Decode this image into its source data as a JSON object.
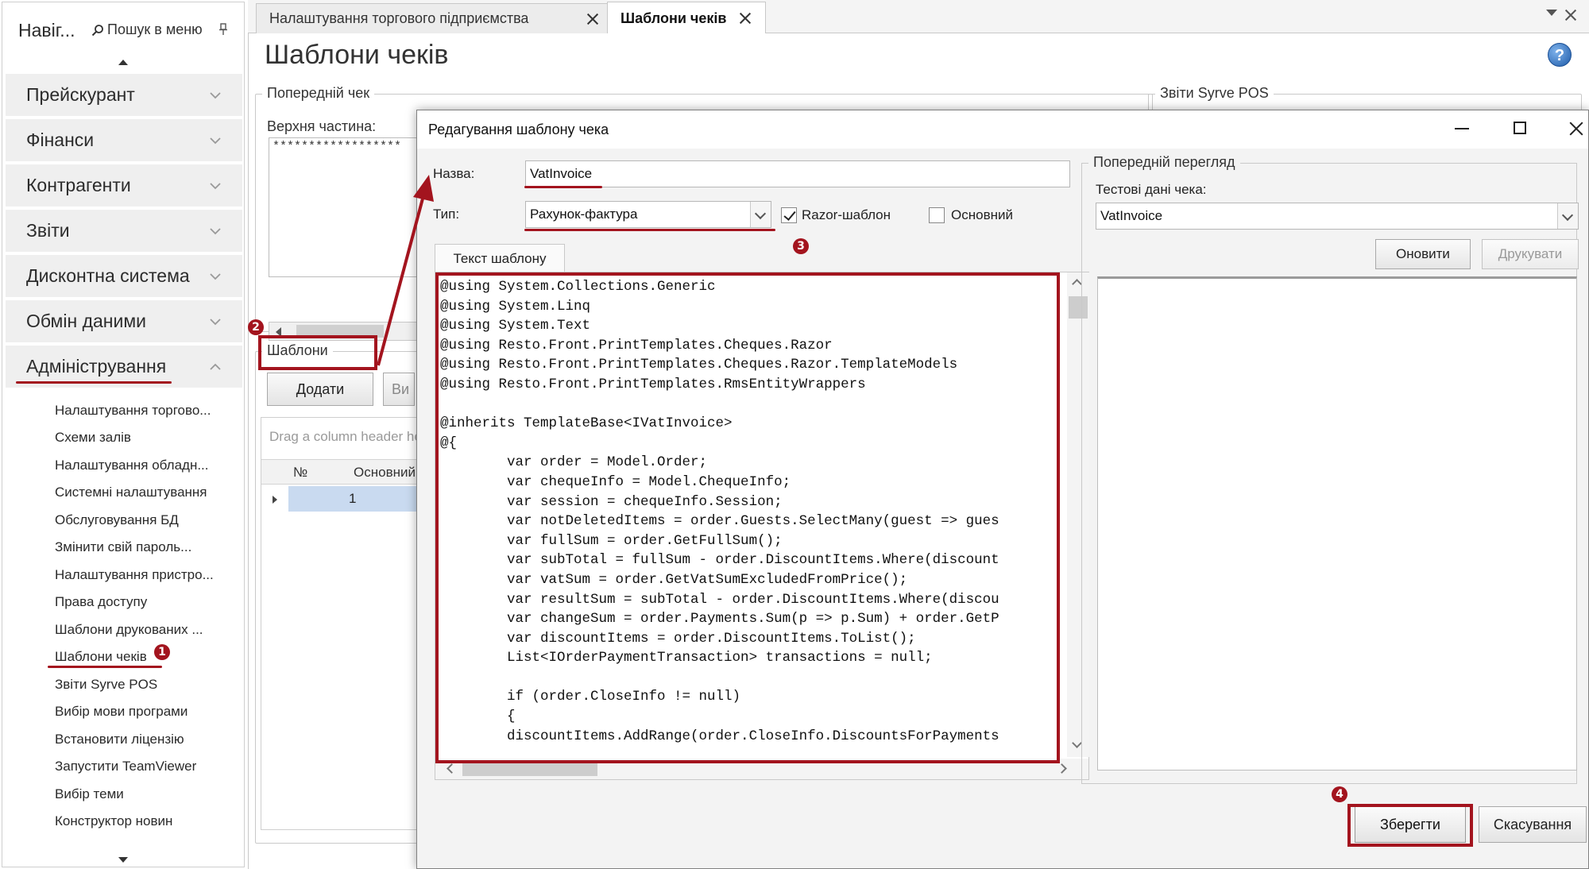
{
  "sidebar": {
    "title": "Навіг...",
    "search_label": "Пошук в меню",
    "groups": [
      {
        "label": "Прейскурант"
      },
      {
        "label": "Фінанси"
      },
      {
        "label": "Контрагенти"
      },
      {
        "label": "Звіти"
      },
      {
        "label": "Дисконтна система"
      },
      {
        "label": "Обмін даними"
      },
      {
        "label": "Адміністрування"
      }
    ],
    "admin_items": [
      "Налаштування торгово...",
      "Схеми залів",
      "Налаштування обладн...",
      "Системні налаштування",
      "Обслуговування БД",
      "Змінити свій пароль...",
      "Налаштування пристро...",
      "Права доступу",
      "Шаблони друкованих ...",
      "Шаблони чеків",
      "Звіти Syrve POS",
      "Вибір мови програми",
      "Встановити ліцензію",
      "Запустити TeamViewer",
      "Вибір теми",
      "Конструктор новин"
    ]
  },
  "tabs": [
    {
      "label": "Налаштування торгового підприємства"
    },
    {
      "label": "Шаблони чеків"
    }
  ],
  "page": {
    "title": "Шаблони чеків",
    "help": "?",
    "prev_cheque_legend": "Попередній чек",
    "top_part_label": "Верхня частина:",
    "top_part_value": "******************",
    "syrve_legend": "Звіти Syrve POS",
    "templates_legend": "Шаблони",
    "add_button": "Додати",
    "second_button_partial": "Ви",
    "drag_hint": "Drag a column header he",
    "grid_columns": [
      "№",
      "Основний"
    ],
    "grid_row_number": "1"
  },
  "dialog": {
    "title": "Редагування шаблону чека",
    "name_label": "Назва:",
    "name_value": "VatInvoice",
    "type_label": "Тип:",
    "type_value": "Рахунок-фактура",
    "razor_label": "Razor-шаблон",
    "razor_checked": true,
    "main_label": "Основний",
    "main_checked": false,
    "code_tab": "Текст шаблону",
    "code_lines": [
      "@using System.Collections.Generic",
      "@using System.Linq",
      "@using System.Text",
      "@using Resto.Front.PrintTemplates.Cheques.Razor",
      "@using Resto.Front.PrintTemplates.Cheques.Razor.TemplateModels",
      "@using Resto.Front.PrintTemplates.RmsEntityWrappers",
      "",
      "@inherits TemplateBase<IVatInvoice>",
      "@{",
      "        var order = Model.Order;",
      "        var chequeInfo = Model.ChequeInfo;",
      "        var session = chequeInfo.Session;",
      "        var notDeletedItems = order.Guests.SelectMany(guest => gues",
      "        var fullSum = order.GetFullSum();",
      "        var subTotal = fullSum - order.DiscountItems.Where(discount",
      "        var vatSum = order.GetVatSumExcludedFromPrice();",
      "        var resultSum = subTotal - order.DiscountItems.Where(discou",
      "        var changeSum = order.Payments.Sum(p => p.Sum) + order.GetP",
      "        var discountItems = order.DiscountItems.ToList();",
      "        List<IOrderPaymentTransaction> transactions = null;",
      "",
      "        if (order.CloseInfo != null)",
      "        {",
      "        discountItems.AddRange(order.CloseInfo.DiscountsForPayments"
    ],
    "preview_legend": "Попередній перегляд",
    "test_data_label": "Тестові дані чека:",
    "test_data_value": "VatInvoice",
    "refresh_button": "Оновити",
    "print_button": "Друкувати",
    "save_button": "Зберегти",
    "cancel_button": "Скасування"
  },
  "annotations": {
    "badges": [
      "1",
      "2",
      "3",
      "4"
    ],
    "color": "#a3141e"
  }
}
